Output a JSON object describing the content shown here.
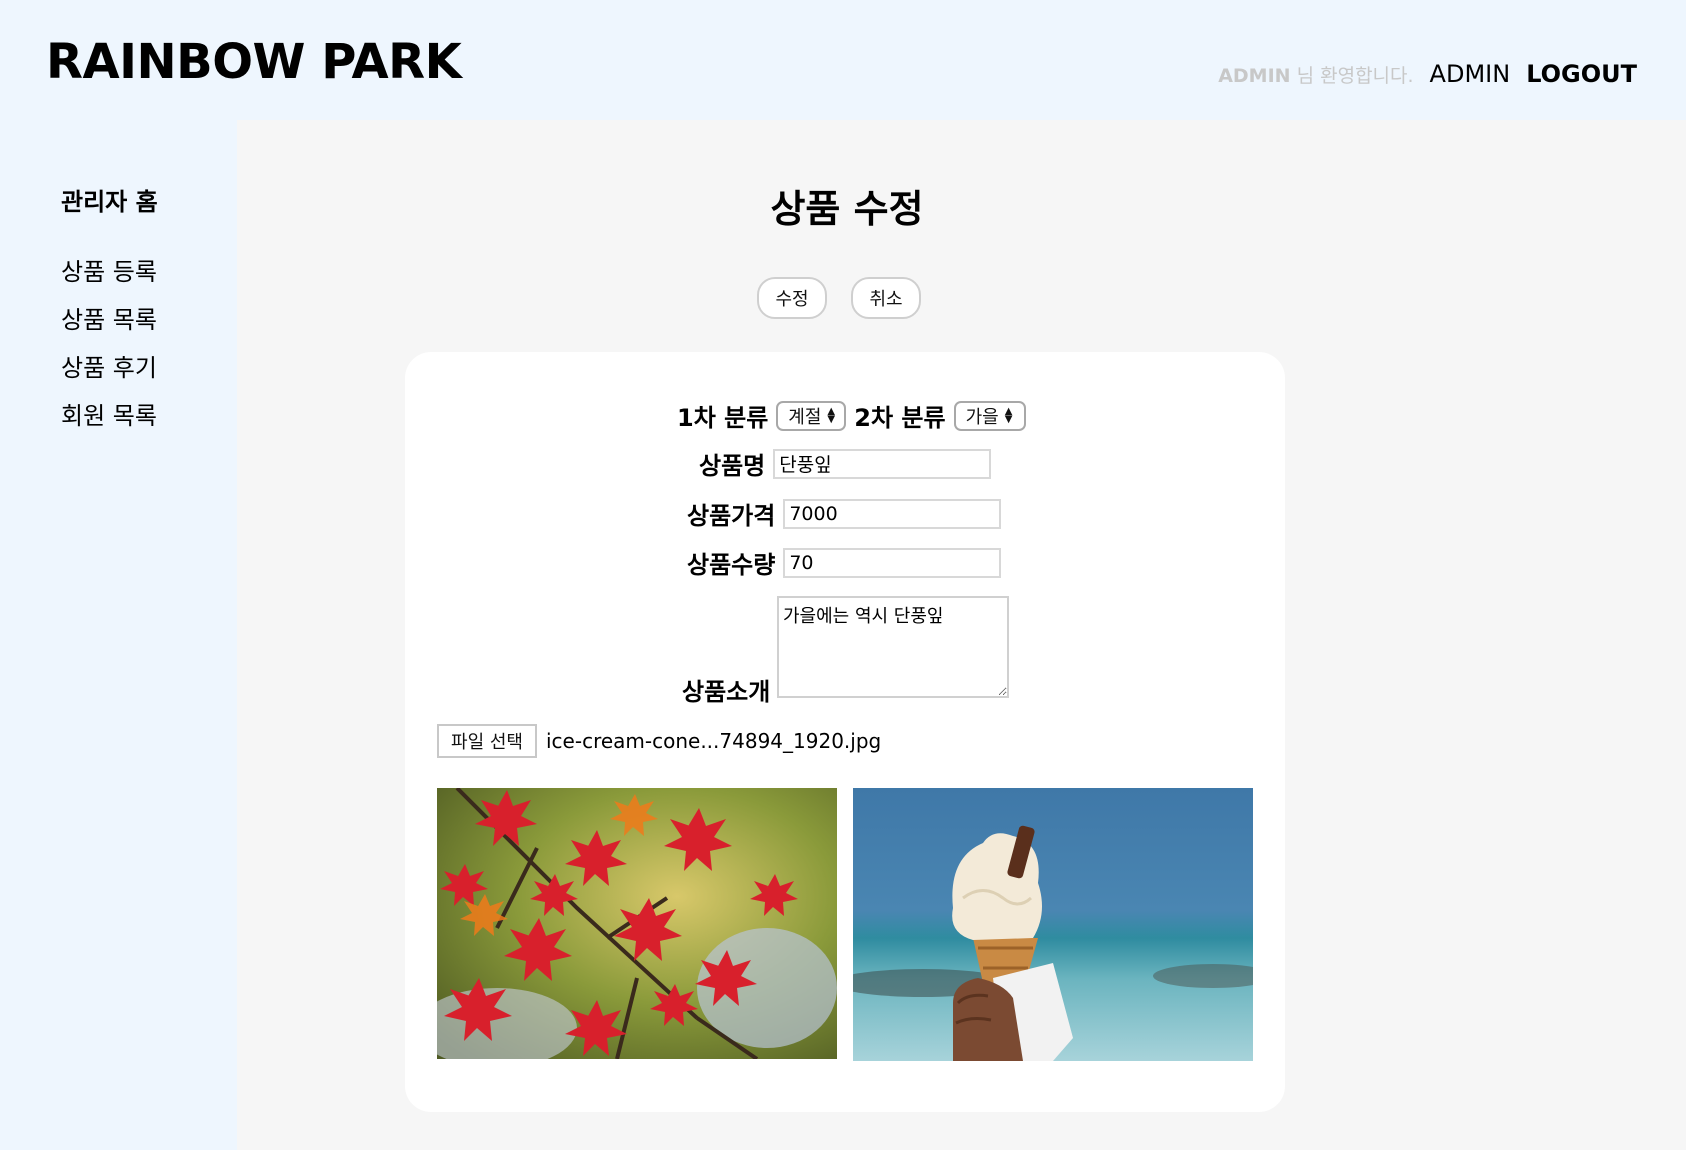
{
  "header": {
    "logo": "RAINBOW PARK",
    "welcome_user": "ADMIN",
    "welcome_suffix": " 님 환영합니다.",
    "admin_link": "ADMIN",
    "logout_link": "LOGOUT"
  },
  "sidebar": {
    "home": "관리자 홈",
    "items": [
      {
        "label": "상품 등록"
      },
      {
        "label": "상품 목록"
      },
      {
        "label": "상품 후기"
      },
      {
        "label": "회원 목록"
      }
    ]
  },
  "main": {
    "title": "상품 수정",
    "buttons": {
      "edit": "수정",
      "cancel": "취소"
    }
  },
  "form": {
    "category1_label": "1차 분류",
    "category1_value": "계절",
    "category2_label": "2차 분류",
    "category2_value": "가을",
    "name_label": "상품명",
    "name_value": "단풍잎",
    "price_label": "상품가격",
    "price_value": "7000",
    "quantity_label": "상품수량",
    "quantity_value": "70",
    "desc_label": "상품소개",
    "desc_value": "가을에는 역시 단풍잎",
    "file_button": "파일 선택",
    "file_name": "ice-cream-cone...74894_1920.jpg"
  },
  "colors": {
    "sidebar_bg": "#eef6fe",
    "main_bg": "#f6f6f6",
    "card_bg": "#ffffff",
    "welcome_text": "#c8c8c8"
  }
}
